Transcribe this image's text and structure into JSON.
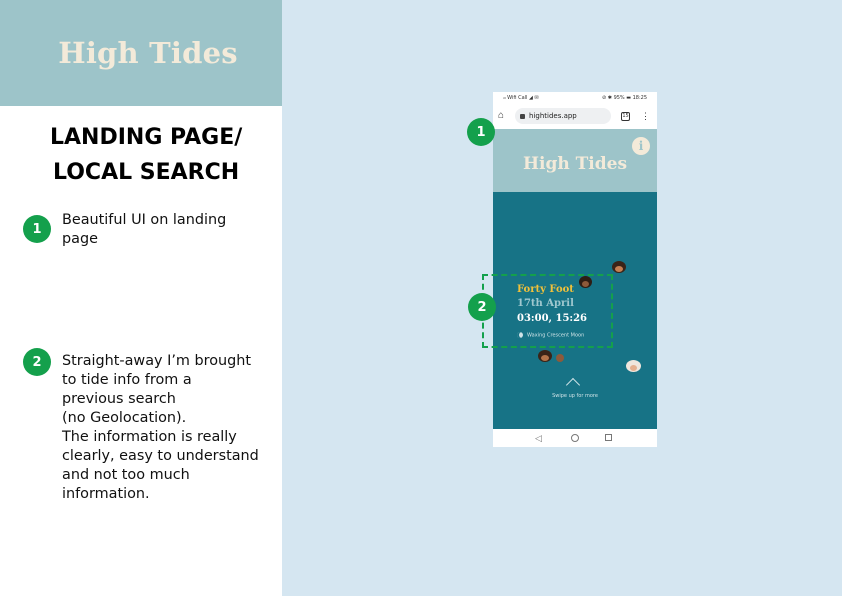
{
  "brand": {
    "title": "High Tides"
  },
  "section": {
    "title_line1": "LANDING PAGE/",
    "title_line2": "LOCAL SEARCH"
  },
  "notes": [
    {
      "number": "1",
      "lines": [
        "Beautiful UI on landing",
        "page"
      ]
    },
    {
      "number": "2",
      "lines": [
        "Straight-away I’m brought",
        "to tide info from a",
        "previous search",
        "(no Geolocation).",
        "The information is really",
        "clearly, easy to understand",
        "and not too much",
        "information."
      ]
    }
  ],
  "phone": {
    "status_left": "ᵢₗₗ Wifi Call ◢ ✉",
    "status_right": "⊘ ✱ 95% ▬ 18:25",
    "url": "hightides.app",
    "tabs_count": "15",
    "app_title": "High Tides",
    "info_icon": "i",
    "location": "Forty Foot",
    "date": "17th April",
    "times": "03:00, 15:26",
    "moon_phase": "Waxing Crescent Moon",
    "swipe_text": "Swipe up for more"
  },
  "callouts": [
    {
      "number": "1"
    },
    {
      "number": "2"
    }
  ],
  "colors": {
    "accent_green": "#14a04c",
    "brand_bar": "#9dc4c9",
    "brand_text": "#f3ead9",
    "right_panel": "#d5e6f1",
    "app_body": "#177386",
    "location_yellow": "#f1c13a"
  },
  "icons": {
    "home": "home-icon",
    "lock": "lock-icon",
    "tabs": "tabs-icon",
    "menu": "more-vert-icon",
    "info": "info-icon",
    "moon": "moon-icon",
    "chevron": "chevron-up-icon",
    "nav_back": "back-triangle-icon",
    "nav_home": "home-circle-icon",
    "nav_recent": "recent-square-icon"
  }
}
